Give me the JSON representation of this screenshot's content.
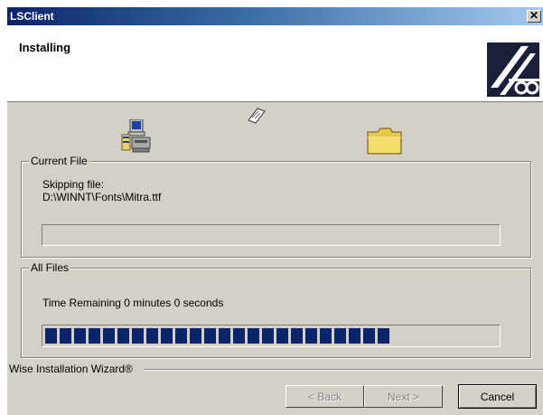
{
  "window": {
    "title": "LSClient",
    "close_glyph": "✕"
  },
  "header": {
    "title": "Installing",
    "logo_icon": "wise-logo-icon"
  },
  "icons": {
    "source": "computer-icon",
    "transfer": "flying-paper-icon",
    "destination": "folder-icon"
  },
  "current_file": {
    "legend": "Current File",
    "status_label": "Skipping file:",
    "path": "D:\\WINNT\\Fonts\\Mitra.ttf",
    "progress_fraction": 0.0
  },
  "all_files": {
    "legend": "All Files",
    "time_remaining": "Time Remaining 0 minutes 0 seconds",
    "progress_fraction": 0.78,
    "progress_color": "#0a246a"
  },
  "footer": {
    "wizard_label": "Wise Installation Wizard®",
    "back_label": "< Back",
    "next_label": "Next >",
    "cancel_label": "Cancel"
  },
  "colors": {
    "titlebar_start": "#0a246a",
    "titlebar_end": "#a6caf0",
    "dialog_face": "#d4d0c8"
  }
}
